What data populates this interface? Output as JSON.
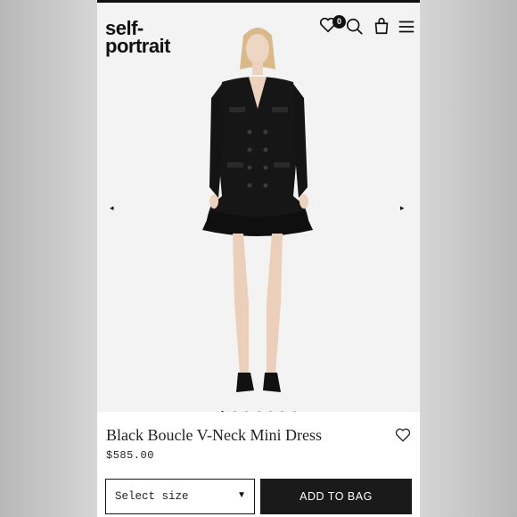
{
  "brand": {
    "logo_line1": "self-",
    "logo_line2": "portrait"
  },
  "header": {
    "wishlist_count": "0",
    "icons": [
      "heart-icon",
      "search-icon",
      "bag-icon",
      "menu-icon"
    ]
  },
  "gallery": {
    "prev_arrow": "◂",
    "next_arrow": "▸",
    "dot_count": 7,
    "active_index": 0
  },
  "product": {
    "name": "Black Boucle V-Neck Mini Dress",
    "price": "$585.00",
    "size_placeholder": "Select size",
    "size_caret": "▼",
    "add_to_bag_label": "ADD TO BAG"
  },
  "colors": {
    "accent": "#1a1a1a",
    "background": "#f3f3f3",
    "dress": "#161616"
  }
}
